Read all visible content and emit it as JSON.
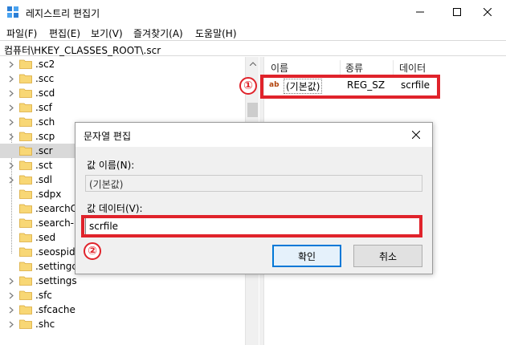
{
  "window": {
    "title": "레지스트리 편집기"
  },
  "menu": [
    "파일(F)",
    "편집(E)",
    "보기(V)",
    "즐겨찾기(A)",
    "도움말(H)"
  ],
  "address": "컴퓨터\\HKEY_CLASSES_ROOT\\.scr",
  "tree": {
    "items": [
      {
        "label": ".sc2",
        "expandable": true,
        "selected": false
      },
      {
        "label": ".scc",
        "expandable": true,
        "selected": false
      },
      {
        "label": ".scd",
        "expandable": true,
        "selected": false
      },
      {
        "label": ".scf",
        "expandable": true,
        "selected": false
      },
      {
        "label": ".sch",
        "expandable": true,
        "selected": false
      },
      {
        "label": ".scp",
        "expandable": true,
        "selected": false
      },
      {
        "label": ".scr",
        "expandable": false,
        "selected": true
      },
      {
        "label": ".sct",
        "expandable": true,
        "selected": false
      },
      {
        "label": ".sdl",
        "expandable": true,
        "selected": false
      },
      {
        "label": ".sdpx",
        "expandable": false,
        "selected": false
      },
      {
        "label": ".searchCo",
        "expandable": false,
        "selected": false
      },
      {
        "label": ".search-m",
        "expandable": false,
        "selected": false
      },
      {
        "label": ".sed",
        "expandable": false,
        "selected": false
      },
      {
        "label": ".seospider",
        "expandable": false,
        "selected": false
      },
      {
        "label": ".settingco",
        "expandable": false,
        "selected": false
      },
      {
        "label": ".settings",
        "expandable": true,
        "selected": false
      },
      {
        "label": ".sfc",
        "expandable": true,
        "selected": false
      },
      {
        "label": ".sfcache",
        "expandable": true,
        "selected": false
      },
      {
        "label": ".shc",
        "expandable": true,
        "selected": false
      }
    ]
  },
  "list": {
    "headers": {
      "name": "이름",
      "type": "종류",
      "data": "데이터"
    },
    "rows": [
      {
        "icon": "ab",
        "name": "(기본값)",
        "type": "REG_SZ",
        "data": "scrfile"
      }
    ]
  },
  "annotations": {
    "badge1": "①",
    "badge2": "②",
    "highlight_color": "#e0232b"
  },
  "dialog": {
    "title": "문자열 편집",
    "name_label": "값 이름(N):",
    "name_value": "(기본값)",
    "data_label": "값 데이터(V):",
    "data_value": "scrfile",
    "ok_label": "확인",
    "cancel_label": "취소"
  },
  "colors": {
    "accent": "#0078d7",
    "selection": "#d9d9d9",
    "folder": "#f8d775"
  }
}
